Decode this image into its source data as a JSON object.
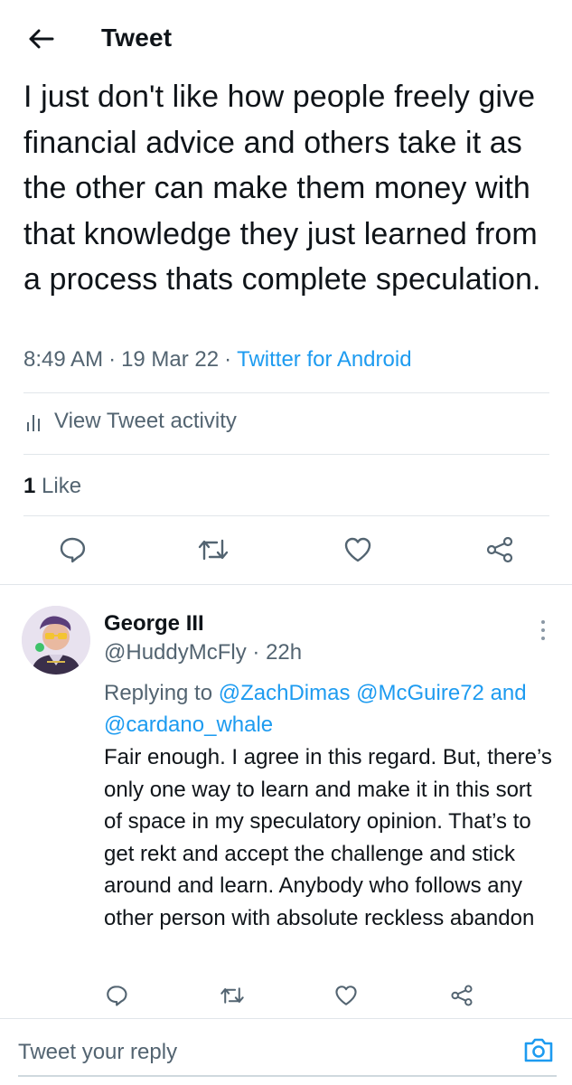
{
  "header": {
    "title": "Tweet"
  },
  "tweet": {
    "text": "I just don't like how people freely give financial advice and others take it as the other can make them money with that knowledge they just learned from a process thats complete speculation.",
    "time": "8:49 AM",
    "date": "19 Mar 22",
    "source": "Twitter for Android",
    "activity_label": "View Tweet activity",
    "like_count": "1",
    "like_label": "Like"
  },
  "reply": {
    "name": "George III",
    "handle": "@HuddyMcFly",
    "age": "22h",
    "replying_prefix": "Replying to",
    "mention1": "@ZachDimas",
    "mention2": "@McGuire72",
    "and": "and",
    "mention3": "@cardano_whale",
    "text": "Fair enough. I agree in this regard. But, there’s only one way to learn and make it in this sort of space in my speculatory opinion. That’s to get rekt and accept the challenge and stick around and learn. Anybody who follows any other person with absolute reckless abandon"
  },
  "compose": {
    "placeholder": "Tweet your reply"
  },
  "colors": {
    "accent": "#1d9bf0",
    "text": "#0f1419",
    "muted": "#536471",
    "divider": "#e1e6ea"
  },
  "icons": [
    "back-arrow-icon",
    "bar-chart-icon",
    "reply-icon",
    "retweet-icon",
    "like-icon",
    "share-icon",
    "more-icon",
    "camera-icon"
  ]
}
